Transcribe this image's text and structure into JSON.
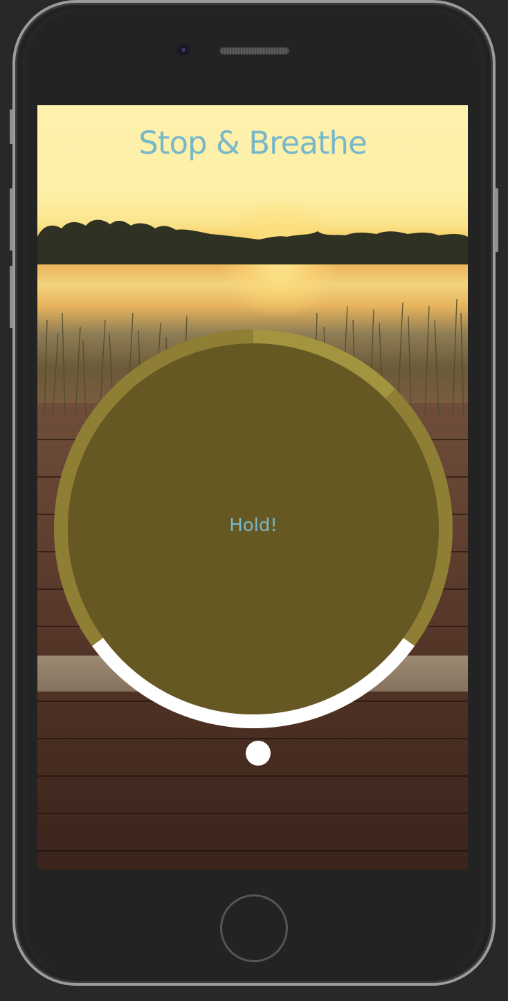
{
  "app": {
    "title": "Stop & Breathe"
  },
  "breath": {
    "instruction": "Hold!",
    "progress_fraction": 0.3
  },
  "colors": {
    "title": "#78b7c8",
    "circle_fill": "#665822",
    "ring_track": "#8f7f35",
    "ring_fill": "#ffffff",
    "instruction_text": "#79b6c6"
  },
  "device": {
    "model": "iphone-frame"
  }
}
